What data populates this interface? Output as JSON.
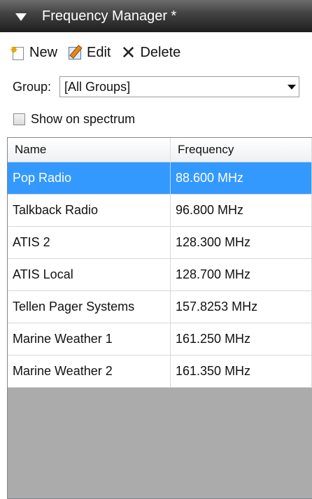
{
  "panel": {
    "title": "Frequency Manager *"
  },
  "toolbar": {
    "new_label": "New",
    "edit_label": "Edit",
    "delete_label": "Delete"
  },
  "group": {
    "label": "Group:",
    "selected": "[All Groups]"
  },
  "show_on_spectrum": {
    "label": "Show on spectrum",
    "checked": false
  },
  "table": {
    "columns": [
      "Name",
      "Frequency"
    ],
    "selected_row": 0,
    "rows": [
      {
        "name": "Pop Radio",
        "frequency": "88.600 MHz"
      },
      {
        "name": "Talkback Radio",
        "frequency": "96.800 MHz"
      },
      {
        "name": "ATIS 2",
        "frequency": "128.300 MHz"
      },
      {
        "name": "ATIS Local",
        "frequency": "128.700 MHz"
      },
      {
        "name": "Tellen Pager Systems",
        "frequency": "157.8253 MHz"
      },
      {
        "name": "Marine Weather 1",
        "frequency": "161.250 MHz"
      },
      {
        "name": "Marine Weather 2",
        "frequency": "161.350 MHz"
      }
    ]
  },
  "colors": {
    "selection": "#3399ff",
    "empty_area": "#ababab"
  },
  "icons": [
    "collapse-triangle-icon",
    "new-document-icon",
    "edit-document-icon",
    "delete-x-icon",
    "dropdown-arrow-icon"
  ]
}
